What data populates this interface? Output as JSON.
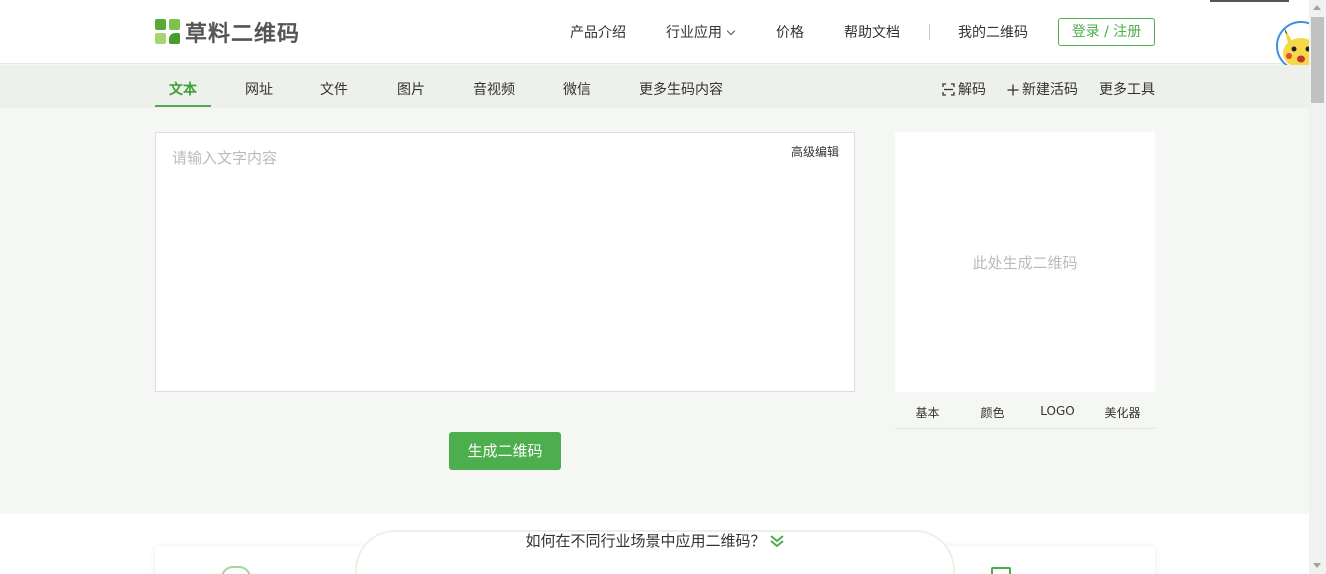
{
  "header": {
    "logo_text": "草料二维码",
    "nav": [
      {
        "label": "产品介绍"
      },
      {
        "label": "行业应用"
      },
      {
        "label": "价格"
      },
      {
        "label": "帮助文档"
      },
      {
        "label": "我的二维码"
      }
    ],
    "login_label": "登录 / 注册"
  },
  "subnav": {
    "tabs": [
      {
        "label": "文本",
        "active": true
      },
      {
        "label": "网址"
      },
      {
        "label": "文件"
      },
      {
        "label": "图片"
      },
      {
        "label": "音视频"
      },
      {
        "label": "微信"
      },
      {
        "label": "更多生码内容"
      }
    ],
    "tools": [
      {
        "label": "解码",
        "icon": "scan-icon"
      },
      {
        "label": "新建活码",
        "icon": "plus-icon"
      },
      {
        "label": "更多工具"
      }
    ]
  },
  "editor": {
    "placeholder": "请输入文字内容",
    "advanced_edit": "高级编辑",
    "generate_button": "生成二维码"
  },
  "qr_preview": {
    "placeholder": "此处生成二维码",
    "tabs": [
      "基本",
      "颜色",
      "LOGO",
      "美化器"
    ]
  },
  "bottom": {
    "title": "如何在不同行业场景中应用二维码？"
  },
  "colors": {
    "accent": "#4cae4c",
    "nav_bg": "#eef0ec",
    "page_bg": "#f4f7f3"
  }
}
